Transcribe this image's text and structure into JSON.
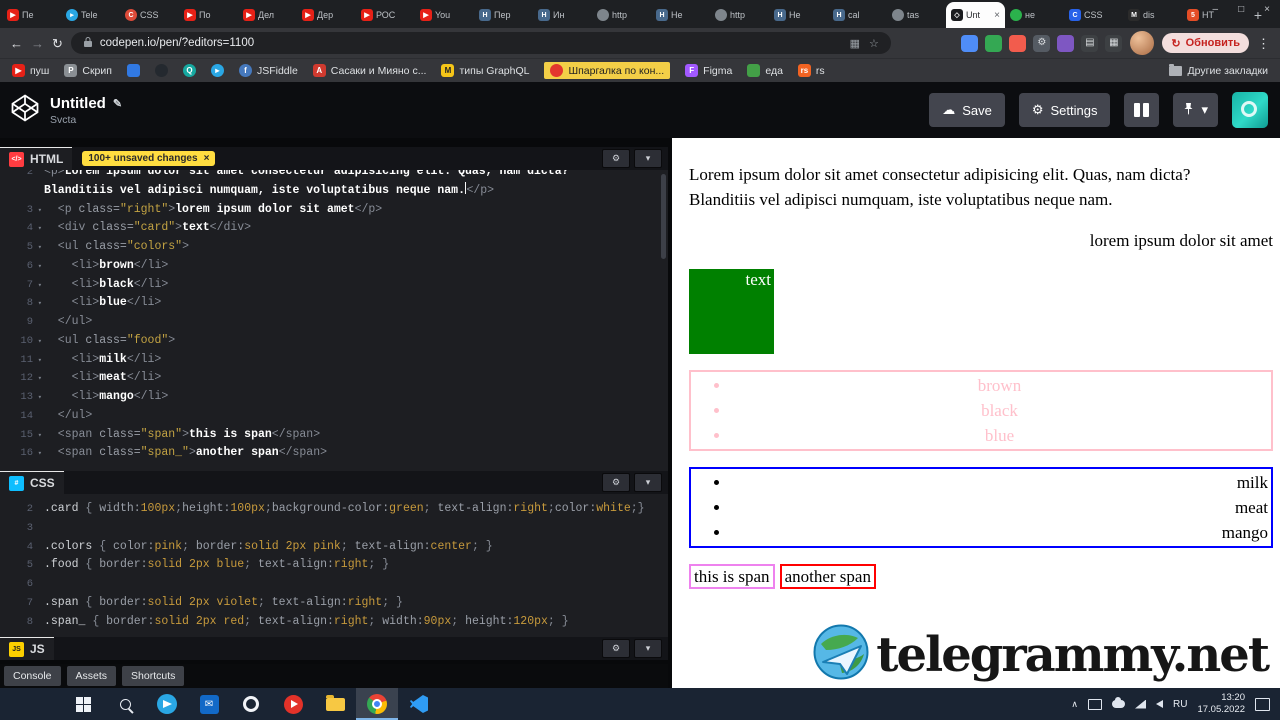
{
  "browser": {
    "window_controls": [
      "–",
      "□",
      "×"
    ],
    "new_tab_label": "+",
    "active_close": "×",
    "back": "←",
    "forward": "→",
    "reload": "↻",
    "star": "☆",
    "media_icon": "▦",
    "menu_icon": "⋮",
    "url": "codepen.io/pen/?editors=1100",
    "update_button": "Обновить",
    "update_icon": "↻",
    "fav_styles": {
      "yt": {
        "bg": "#e62117",
        "ch": "▶"
      },
      "tg": {
        "bg": "#2aa7e4",
        "ch": "▸",
        "round": true
      },
      "redc": {
        "bg": "#dd4b39",
        "ch": "C",
        "round": true
      },
      "habr": {
        "bg": "#48698c",
        "ch": "H"
      },
      "globe": {
        "bg": "#7e858c",
        "ch": "",
        "round": true
      },
      "cp": {
        "bg": "#1b1c1f",
        "ch": "◇",
        "fg": "#ffffff"
      },
      "green": {
        "bg": "#2bb24c",
        "ch": "",
        "round": true
      },
      "bluec": {
        "bg": "#2862e9",
        "ch": "C"
      },
      "mdark": {
        "bg": "#2b2b2b",
        "ch": "M"
      },
      "orange": {
        "bg": "#e44d26",
        "ch": "5"
      },
      "P": {
        "bg": "#8a8f94",
        "ch": "P"
      },
      "A": {
        "bg": "#d03a2f",
        "ch": "A"
      },
      "M": {
        "bg": "#f5c518",
        "ch": "M",
        "fg": "#222222"
      },
      "reddot": {
        "bg": "#e3372e",
        "ch": "",
        "round": true
      },
      "figma": {
        "bg": "#a259ff",
        "ch": "F"
      },
      "jsf": {
        "bg": "#4679bd",
        "ch": "f",
        "round": true
      },
      "teal": {
        "bg": "#16a8a0",
        "ch": "Q",
        "round": true
      },
      "blu2": {
        "bg": "#3179e3",
        "ch": ""
      },
      "gh": {
        "bg": "#24292f",
        "ch": "",
        "round": true
      },
      "rs": {
        "bg": "#f26322",
        "ch": "rs"
      },
      "green2": {
        "bg": "#43a047",
        "ch": ""
      }
    },
    "tabs": [
      {
        "label": "Пе",
        "fav": "yt"
      },
      {
        "label": "Tele",
        "fav": "tg"
      },
      {
        "label": "CSS",
        "fav": "redc"
      },
      {
        "label": "По",
        "fav": "yt"
      },
      {
        "label": "Дел",
        "fav": "yt"
      },
      {
        "label": "Дер",
        "fav": "yt"
      },
      {
        "label": "РОС",
        "fav": "yt"
      },
      {
        "label": "You",
        "fav": "yt"
      },
      {
        "label": "Пер",
        "fav": "habr"
      },
      {
        "label": "Ин",
        "fav": "habr"
      },
      {
        "label": "http",
        "fav": "globe"
      },
      {
        "label": "Не",
        "fav": "habr"
      },
      {
        "label": "http",
        "fav": "globe"
      },
      {
        "label": "Не",
        "fav": "habr"
      },
      {
        "label": "cal",
        "fav": "habr"
      },
      {
        "label": "tas",
        "fav": "globe"
      },
      {
        "label": "Unt",
        "fav": "cp",
        "active": true
      },
      {
        "label": "не",
        "fav": "green"
      },
      {
        "label": "CSS",
        "fav": "bluec"
      },
      {
        "label": "dis",
        "fav": "mdark"
      },
      {
        "label": "HT",
        "fav": "orange"
      }
    ],
    "extensions": [
      {
        "bg": "#4f8df7",
        "ch": ""
      },
      {
        "bg": "#34a853",
        "ch": ""
      },
      {
        "bg": "#f25c4d",
        "ch": ""
      },
      {
        "bg": "#555b63",
        "ch": "⚙",
        "fg": "#d8dbde"
      },
      {
        "bg": "#7e57c2",
        "ch": ""
      },
      {
        "bg": "#3d4043",
        "ch": "▤",
        "fg": "#d8dbde"
      },
      {
        "bg": "#3d4043",
        "ch": "▦",
        "fg": "#d8dbde"
      }
    ],
    "bookmarks": [
      {
        "label": "пуш",
        "fav": "yt"
      },
      {
        "label": "Скрип",
        "fav": "P"
      },
      {
        "label": "",
        "fav": "blu2"
      },
      {
        "label": "",
        "fav": "gh"
      },
      {
        "label": "",
        "fav": "teal"
      },
      {
        "label": "",
        "fav": "tg"
      },
      {
        "label": "JSFiddle",
        "fav": "jsf"
      },
      {
        "label": "Сасаки и Мияно с...",
        "fav": "A"
      },
      {
        "label": "типы GraphQL",
        "fav": "M"
      },
      {
        "label": "Шпаргалка по кон...",
        "fav": "reddot",
        "highlight": true
      },
      {
        "label": "Figma",
        "fav": "figma"
      },
      {
        "label": "еда",
        "fav": "green2"
      },
      {
        "label": "rs",
        "fav": "rs"
      }
    ],
    "other_bookmarks": "Другие закладки"
  },
  "pen_header": {
    "title": "Untitled",
    "edit_icon": "✎",
    "author": "Svcta",
    "save": "Save",
    "save_icon": "☁",
    "settings": "Settings",
    "settings_icon": "⚙",
    "chevron": "▾"
  },
  "editors": {
    "controls": {
      "gear": "⚙",
      "collapse": "▾"
    },
    "html": {
      "label": "HTML",
      "badge": "100+ unsaved changes",
      "badge_close": "×",
      "lines": [
        {
          "n": "2",
          "t": [
            [
              "tag",
              "<p>"
            ],
            [
              "txt",
              "Lorem ipsum dolor sit amet consectetur adipisicing elit. Quas, nam dicta?"
            ]
          ]
        },
        {
          "n": "",
          "t": [
            [
              "txt",
              "Blanditiis vel adipisci numquam, iste voluptatibus neque nam."
            ],
            [
              "cur",
              ""
            ],
            [
              "tag",
              "</p>"
            ]
          ]
        },
        {
          "n": "3",
          "fold": true,
          "t": [
            [
              "tag",
              "  <p "
            ],
            [
              "attr",
              "class="
            ],
            [
              "str",
              "\"right\""
            ],
            [
              "tag",
              ">"
            ],
            [
              "txt",
              "lorem ipsum dolor sit amet"
            ],
            [
              "tag",
              "</p>"
            ]
          ]
        },
        {
          "n": "4",
          "fold": true,
          "t": [
            [
              "tag",
              "  <div "
            ],
            [
              "attr",
              "class="
            ],
            [
              "str",
              "\"card\""
            ],
            [
              "tag",
              ">"
            ],
            [
              "txt",
              "text"
            ],
            [
              "tag",
              "</div>"
            ]
          ]
        },
        {
          "n": "5",
          "fold": true,
          "t": [
            [
              "tag",
              "  <ul "
            ],
            [
              "attr",
              "class="
            ],
            [
              "str",
              "\"colors\""
            ],
            [
              "tag",
              ">"
            ]
          ]
        },
        {
          "n": "6",
          "fold": true,
          "t": [
            [
              "tag",
              "    <li>"
            ],
            [
              "txt",
              "brown"
            ],
            [
              "tag",
              "</li>"
            ]
          ]
        },
        {
          "n": "7",
          "fold": true,
          "t": [
            [
              "tag",
              "    <li>"
            ],
            [
              "txt",
              "black"
            ],
            [
              "tag",
              "</li>"
            ]
          ]
        },
        {
          "n": "8",
          "fold": true,
          "t": [
            [
              "tag",
              "    <li>"
            ],
            [
              "txt",
              "blue"
            ],
            [
              "tag",
              "</li>"
            ]
          ]
        },
        {
          "n": "9",
          "t": [
            [
              "tag",
              "  </ul>"
            ]
          ]
        },
        {
          "n": "10",
          "fold": true,
          "t": [
            [
              "tag",
              "  <ul "
            ],
            [
              "attr",
              "class="
            ],
            [
              "str",
              "\"food\""
            ],
            [
              "tag",
              ">"
            ]
          ]
        },
        {
          "n": "11",
          "fold": true,
          "t": [
            [
              "tag",
              "    <li>"
            ],
            [
              "txt",
              "milk"
            ],
            [
              "tag",
              "</li>"
            ]
          ]
        },
        {
          "n": "12",
          "fold": true,
          "t": [
            [
              "tag",
              "    <li>"
            ],
            [
              "txt",
              "meat"
            ],
            [
              "tag",
              "</li>"
            ]
          ]
        },
        {
          "n": "13",
          "fold": true,
          "t": [
            [
              "tag",
              "    <li>"
            ],
            [
              "txt",
              "mango"
            ],
            [
              "tag",
              "</li>"
            ]
          ]
        },
        {
          "n": "14",
          "t": [
            [
              "tag",
              "  </ul>"
            ]
          ]
        },
        {
          "n": "15",
          "fold": true,
          "t": [
            [
              "tag",
              "  <span "
            ],
            [
              "attr",
              "class="
            ],
            [
              "str",
              "\"span\""
            ],
            [
              "tag",
              ">"
            ],
            [
              "txt",
              "this is span"
            ],
            [
              "tag",
              "</span>"
            ]
          ]
        },
        {
          "n": "16",
          "fold": true,
          "t": [
            [
              "tag",
              "  <span "
            ],
            [
              "attr",
              "class="
            ],
            [
              "str",
              "\"span_\""
            ],
            [
              "tag",
              ">"
            ],
            [
              "txt",
              "another span"
            ],
            [
              "tag",
              "</span>"
            ]
          ]
        }
      ]
    },
    "css": {
      "label": "CSS",
      "lines": [
        {
          "n": "2",
          "t": [
            [
              "sel",
              ".card"
            ],
            [
              "pun",
              " { "
            ],
            [
              "prop",
              "width:"
            ],
            [
              "val",
              "100px"
            ],
            [
              "pun",
              ";"
            ],
            [
              "prop",
              "height:"
            ],
            [
              "val",
              "100px"
            ],
            [
              "pun",
              ";"
            ],
            [
              "prop",
              "background-color:"
            ],
            [
              "val",
              "green"
            ],
            [
              "pun",
              "; "
            ],
            [
              "prop",
              "text-align:"
            ],
            [
              "val",
              "right"
            ],
            [
              "pun",
              ";"
            ],
            [
              "prop",
              "color:"
            ],
            [
              "val",
              "white"
            ],
            [
              "pun",
              ";}"
            ]
          ]
        },
        {
          "n": "3",
          "t": []
        },
        {
          "n": "4",
          "t": [
            [
              "sel",
              ".colors"
            ],
            [
              "pun",
              " { "
            ],
            [
              "prop",
              "color:"
            ],
            [
              "val",
              "pink"
            ],
            [
              "pun",
              "; "
            ],
            [
              "prop",
              "border:"
            ],
            [
              "val",
              "solid 2px pink"
            ],
            [
              "pun",
              "; "
            ],
            [
              "prop",
              "text-align:"
            ],
            [
              "val",
              "center"
            ],
            [
              "pun",
              "; }"
            ]
          ]
        },
        {
          "n": "5",
          "t": [
            [
              "sel",
              ".food"
            ],
            [
              "pun",
              " { "
            ],
            [
              "prop",
              "border:"
            ],
            [
              "val",
              "solid 2px blue"
            ],
            [
              "pun",
              "; "
            ],
            [
              "prop",
              "text-align:"
            ],
            [
              "val",
              "right"
            ],
            [
              "pun",
              "; }"
            ]
          ]
        },
        {
          "n": "6",
          "t": []
        },
        {
          "n": "7",
          "t": [
            [
              "sel",
              ".span"
            ],
            [
              "pun",
              " { "
            ],
            [
              "prop",
              "border:"
            ],
            [
              "val",
              "solid 2px violet"
            ],
            [
              "pun",
              "; "
            ],
            [
              "prop",
              "text-align:"
            ],
            [
              "val",
              "right"
            ],
            [
              "pun",
              "; }"
            ]
          ]
        },
        {
          "n": "8",
          "t": [
            [
              "sel",
              ".span_"
            ],
            [
              "pun",
              " { "
            ],
            [
              "prop",
              "border:"
            ],
            [
              "val",
              "solid 2px red"
            ],
            [
              "pun",
              "; "
            ],
            [
              "prop",
              "text-align:"
            ],
            [
              "val",
              "right"
            ],
            [
              "pun",
              "; "
            ],
            [
              "prop",
              "width:"
            ],
            [
              "val",
              "90px"
            ],
            [
              "pun",
              "; "
            ],
            [
              "prop",
              "height:"
            ],
            [
              "val",
              "120px"
            ],
            [
              "pun",
              "; }"
            ]
          ]
        }
      ]
    },
    "js": {
      "label": "JS"
    }
  },
  "footer": {
    "buttons": [
      "Console",
      "Assets",
      "Shortcuts"
    ]
  },
  "preview": {
    "paragraph": "Lorem ipsum dolor sit amet consectetur adipisicing elit. Quas, nam dicta? Blanditiis vel adipisci numquam, iste voluptatibus neque nam.",
    "right_paragraph": "lorem ipsum dolor sit amet",
    "card_text": "text",
    "colors_list": [
      "brown",
      "black",
      "blue"
    ],
    "food_list": [
      "milk",
      "meat",
      "mango"
    ],
    "span1": "this is span",
    "span2": "another span",
    "watermark": "telegrammy.net",
    "colors": {
      "card_bg": "#008000",
      "pink": "#ffc0cb",
      "blue": "#0000ff",
      "violet": "#ee82ee",
      "red": "#ff0000"
    }
  },
  "taskbar": {
    "apps": [
      {
        "type": "start",
        "name": "start-button"
      },
      {
        "type": "search",
        "name": "search-button"
      },
      {
        "type": "telegram",
        "name": "taskbar-telegram"
      },
      {
        "type": "mail",
        "ch": "✉",
        "name": "taskbar-mail"
      },
      {
        "type": "ring",
        "name": "taskbar-app"
      },
      {
        "type": "yt",
        "name": "taskbar-youtube"
      },
      {
        "type": "folder",
        "name": "taskbar-explorer"
      },
      {
        "type": "chrome",
        "active": true,
        "name": "taskbar-chrome"
      },
      {
        "type": "vscode",
        "name": "taskbar-vscode"
      }
    ],
    "tray": [
      {
        "type": "caret",
        "ch": "∧",
        "name": "tray-expand-icon"
      },
      {
        "type": "mon",
        "name": "display-tray-icon"
      },
      {
        "type": "cloud",
        "name": "onedrive-tray-icon"
      },
      {
        "type": "net",
        "name": "network-tray-icon"
      },
      {
        "type": "vol",
        "name": "volume-tray-icon"
      }
    ],
    "lang": "RU",
    "time": "13:20",
    "date": "17.05.2022"
  }
}
